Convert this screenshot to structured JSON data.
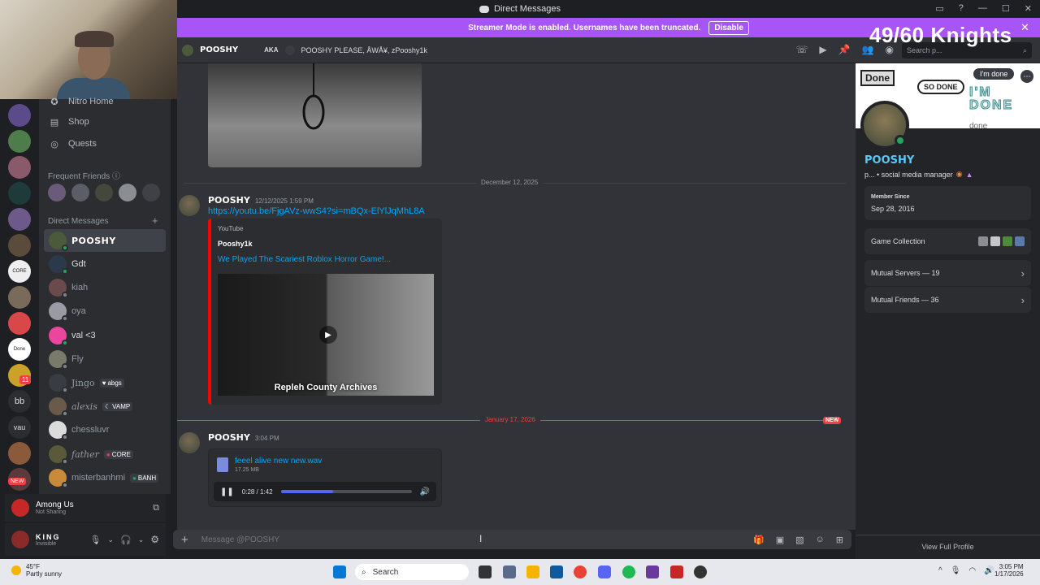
{
  "window": {
    "title": "Direct Messages"
  },
  "banner": {
    "text": "Streamer Mode is enabled. Usernames have been truncated.",
    "button": "Disable"
  },
  "overlay": {
    "counter": "49/60 Knights"
  },
  "sidebar": {
    "nav": [
      {
        "label": "Nitro Home",
        "icon": "nitro-icon"
      },
      {
        "label": "Shop",
        "icon": "shop-icon"
      },
      {
        "label": "Quests",
        "icon": "quests-icon"
      }
    ],
    "frequent_label": "Frequent Friends",
    "dm_label": "Direct Messages",
    "dms": [
      {
        "name": "POOSHY",
        "active": true
      },
      {
        "name": "Gdt"
      },
      {
        "name": "kiah"
      },
      {
        "name": "oya"
      },
      {
        "name": "val <3"
      },
      {
        "name": "Fly"
      },
      {
        "name": "Jingo",
        "tag": "abgs"
      },
      {
        "name": "alexis",
        "tag": "VAMP"
      },
      {
        "name": "chessluvr"
      },
      {
        "name": "father",
        "tag": "CORE"
      },
      {
        "name": "misterbanhmi",
        "tag": "BANH"
      }
    ],
    "activity": {
      "title": "Among Us",
      "sub": "Not Sharing"
    },
    "user": {
      "name": "KING",
      "status": "Invisible"
    }
  },
  "servers": {
    "labels": [
      "bb",
      "vau"
    ],
    "new_badge": "NEW",
    "mention_count": "11"
  },
  "chat_header": {
    "name": "POOSHY",
    "aka_label": "AKA",
    "aka": "POOSHY PLEASE, ÅWÅ¥, zPooshy1k",
    "search_placeholder": "Search p..."
  },
  "messages": {
    "date1": "December 12, 2025",
    "msg1": {
      "author": "POOSHY",
      "time": "12/12/2025 1:59 PM",
      "link": "https://youtu.be/FjgAVz-wwS4?si=mBQx-ElYlJqMhL8A",
      "embed": {
        "provider": "YouTube",
        "author": "Pooshy1k",
        "title": "We Played The Scariest Roblox Horror Game!...",
        "caption": "Repleh County Archives"
      }
    },
    "date2": "January 17, 2026",
    "new_label": "NEW",
    "msg2": {
      "author": "POOSHY",
      "time": "3:04 PM",
      "file": {
        "name": "feeel alive new new.wav",
        "size": "17.25 MB",
        "time": "0:28 / 1:42",
        "progress": 0.4
      }
    }
  },
  "composer": {
    "placeholder": "Message @POOSHY"
  },
  "profile": {
    "banner_texts": [
      "Done",
      "SO DONE",
      "I'M DONE",
      "I'm done",
      "done"
    ],
    "name": "POOSHY",
    "sub": "p... • social media manager",
    "member_since_label": "Member Since",
    "member_since": "Sep 28, 2016",
    "game_collection": "Game Collection",
    "mutual_servers": "Mutual Servers — 19",
    "mutual_friends": "Mutual Friends — 36",
    "view_full": "View Full Profile"
  },
  "taskbar": {
    "weather_temp": "45°F",
    "weather_desc": "Partly sunny",
    "search": "Search",
    "time": "3:05 PM",
    "date": "1/17/2026"
  },
  "colors": {
    "accent": "#a855f7",
    "link": "#00a8fc",
    "online": "#23a55a",
    "new": "#f23f43"
  }
}
